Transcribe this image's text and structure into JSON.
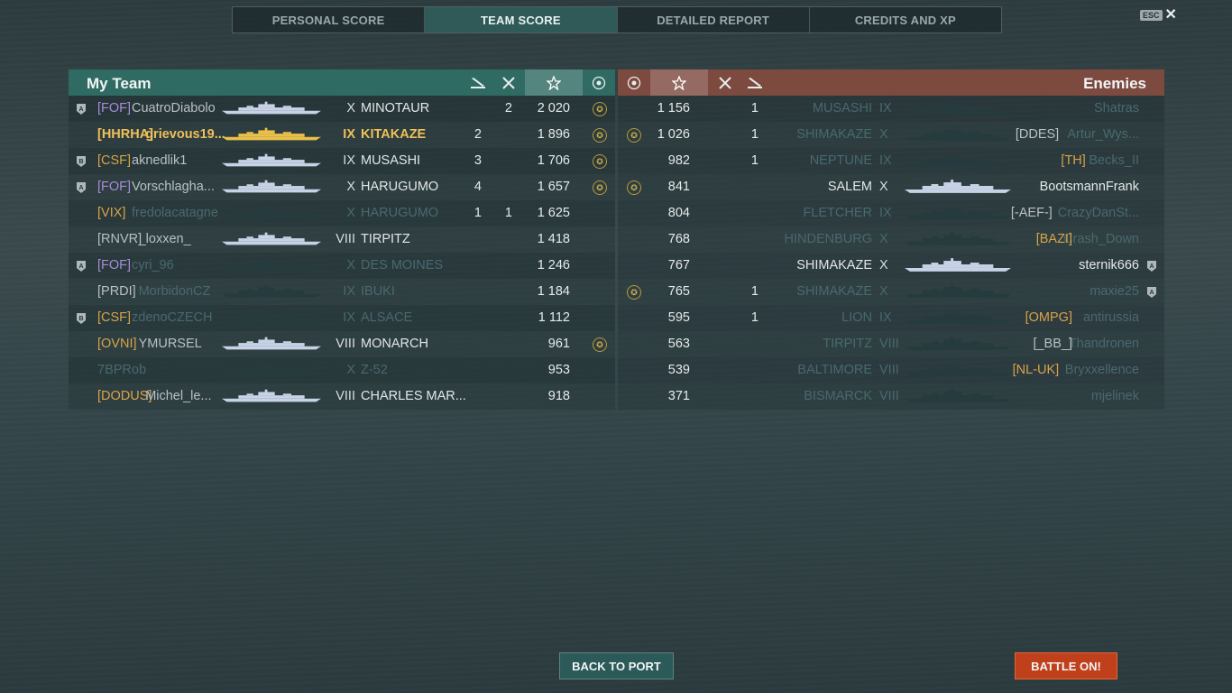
{
  "tabs": [
    "PERSONAL SCORE",
    "TEAM SCORE",
    "DETAILED REPORT",
    "CREDITS AND XP"
  ],
  "active_tab": 1,
  "esc_label": "ESC",
  "my_team": {
    "title": "My Team",
    "rows": [
      {
        "badge": "A",
        "clan": "[FOF]",
        "name": "CuatroDiabolo",
        "tier": "X",
        "ship": "MINOTAUR",
        "c1": "",
        "c2": "2",
        "score": "2 020",
        "medal": true,
        "style": "purple"
      },
      {
        "badge": "",
        "clan": "[HHRHA]",
        "name": "grievous19...",
        "tier": "IX",
        "ship": "KITAKAZE",
        "c1": "2",
        "c2": "",
        "score": "1 896",
        "medal": true,
        "style": "player"
      },
      {
        "badge": "B",
        "clan": "[CSF]",
        "name": "aknedlik1",
        "tier": "IX",
        "ship": "MUSASHI",
        "c1": "3",
        "c2": "",
        "score": "1 706",
        "medal": true,
        "style": "orange"
      },
      {
        "badge": "A",
        "clan": "[FOF]",
        "name": "Vorschlagha...",
        "tier": "X",
        "ship": "HARUGUMO",
        "c1": "4",
        "c2": "",
        "score": "1 657",
        "medal": true,
        "style": "purple"
      },
      {
        "badge": "",
        "clan": "[VIX]",
        "name": "fredolacatagne",
        "tier": "X",
        "ship": "HARUGUMO",
        "c1": "1",
        "c2": "1",
        "score": "1 625",
        "medal": false,
        "style": "orange",
        "dead": true
      },
      {
        "badge": "",
        "clan": "[RNVR]",
        "name": "_loxxen_",
        "tier": "VIII",
        "ship": "TIRPITZ",
        "c1": "",
        "c2": "",
        "score": "1 418",
        "medal": false,
        "style": "gray"
      },
      {
        "badge": "A",
        "clan": "[FOF]",
        "name": "cyri_96",
        "tier": "X",
        "ship": "DES MOINES",
        "c1": "",
        "c2": "",
        "score": "1 246",
        "medal": false,
        "style": "purple",
        "dead": true
      },
      {
        "badge": "",
        "clan": "[PRDI]",
        "name": "MorbidonCZ",
        "tier": "IX",
        "ship": "IBUKI",
        "c1": "",
        "c2": "",
        "score": "1 184",
        "medal": false,
        "style": "gray",
        "dead": true
      },
      {
        "badge": "B",
        "clan": "[CSF]",
        "name": "zdenoCZECH",
        "tier": "IX",
        "ship": "ALSACE",
        "c1": "",
        "c2": "",
        "score": "1 112",
        "medal": false,
        "style": "orange",
        "dead": true
      },
      {
        "badge": "",
        "clan": "[OVNI]",
        "name": "YMURSEL",
        "tier": "VIII",
        "ship": "MONARCH",
        "c1": "",
        "c2": "",
        "score": "961",
        "medal": true,
        "style": "orange"
      },
      {
        "badge": "",
        "clan": "",
        "name": "7BPRob",
        "tier": "X",
        "ship": "Z-52",
        "c1": "",
        "c2": "",
        "score": "953",
        "medal": false,
        "style": "gray",
        "dead": true
      },
      {
        "badge": "",
        "clan": "[DODUS]",
        "name": "Michel_le...",
        "tier": "VIII",
        "ship": "CHARLES MAR...",
        "c1": "",
        "c2": "",
        "score": "918",
        "medal": false,
        "style": "orange"
      }
    ]
  },
  "enemies": {
    "title": "Enemies",
    "rows": [
      {
        "medal": false,
        "score": "1 156",
        "c2": "1",
        "c1": "",
        "ship": "MUSASHI",
        "tier": "IX",
        "clan": "",
        "name": "Shatras",
        "badge": "",
        "style": "gray",
        "dead": true
      },
      {
        "medal": true,
        "score": "1 026",
        "c2": "1",
        "c1": "",
        "ship": "SHIMAKAZE",
        "tier": "X",
        "clan": "[DDES]",
        "name": "Artur_Wys...",
        "badge": "",
        "style": "gray",
        "dead": true
      },
      {
        "medal": false,
        "score": "982",
        "c2": "1",
        "c1": "",
        "ship": "NEPTUNE",
        "tier": "IX",
        "clan": "[TH]",
        "name": "Becks_II",
        "badge": "",
        "style": "orange",
        "dead": true
      },
      {
        "medal": true,
        "score": "841",
        "c2": "",
        "c1": "",
        "ship": "SALEM",
        "tier": "X",
        "clan": "",
        "name": "BootsmannFrank",
        "badge": "",
        "style": "gray"
      },
      {
        "medal": false,
        "score": "804",
        "c2": "",
        "c1": "",
        "ship": "FLETCHER",
        "tier": "IX",
        "clan": "[-AEF-]",
        "name": "CrazyDanSt...",
        "badge": "",
        "style": "gray",
        "dead": true
      },
      {
        "medal": false,
        "score": "768",
        "c2": "",
        "c1": "",
        "ship": "HINDENBURG",
        "tier": "X",
        "clan": "[BAZI]",
        "name": "Crash_Down",
        "badge": "",
        "style": "orange",
        "dead": true
      },
      {
        "medal": false,
        "score": "767",
        "c2": "",
        "c1": "",
        "ship": "SHIMAKAZE",
        "tier": "X",
        "clan": "",
        "name": "sternik666",
        "badge": "A",
        "style": "gray"
      },
      {
        "medal": true,
        "score": "765",
        "c2": "1",
        "c1": "",
        "ship": "SHIMAKAZE",
        "tier": "X",
        "clan": "",
        "name": "maxie25",
        "badge": "A",
        "style": "gray",
        "dead": true
      },
      {
        "medal": false,
        "score": "595",
        "c2": "1",
        "c1": "",
        "ship": "LION",
        "tier": "IX",
        "clan": "[OMPG]",
        "name": "antirussia",
        "badge": "",
        "style": "orange",
        "dead": true
      },
      {
        "medal": false,
        "score": "563",
        "c2": "",
        "c1": "",
        "ship": "TIRPITZ",
        "tier": "VIII",
        "clan": "[_BB_]",
        "name": "Thandronen",
        "badge": "",
        "style": "gray",
        "dead": true
      },
      {
        "medal": false,
        "score": "539",
        "c2": "",
        "c1": "",
        "ship": "BALTIMORE",
        "tier": "VIII",
        "clan": "[NL-UK]",
        "name": "Bryxxellence",
        "badge": "",
        "style": "orange",
        "dead": true
      },
      {
        "medal": false,
        "score": "371",
        "c2": "",
        "c1": "",
        "ship": "BISMARCK",
        "tier": "VIII",
        "clan": "",
        "name": "mjelinek",
        "badge": "",
        "style": "gray",
        "dead": true
      }
    ]
  },
  "buttons": {
    "back": "BACK TO PORT",
    "battle": "BATTLE ON!"
  },
  "colors": {
    "my_team": "#306b63",
    "enemies": "#7d4a40",
    "player": "#f0c058",
    "battle_btn": "#c0401b"
  }
}
